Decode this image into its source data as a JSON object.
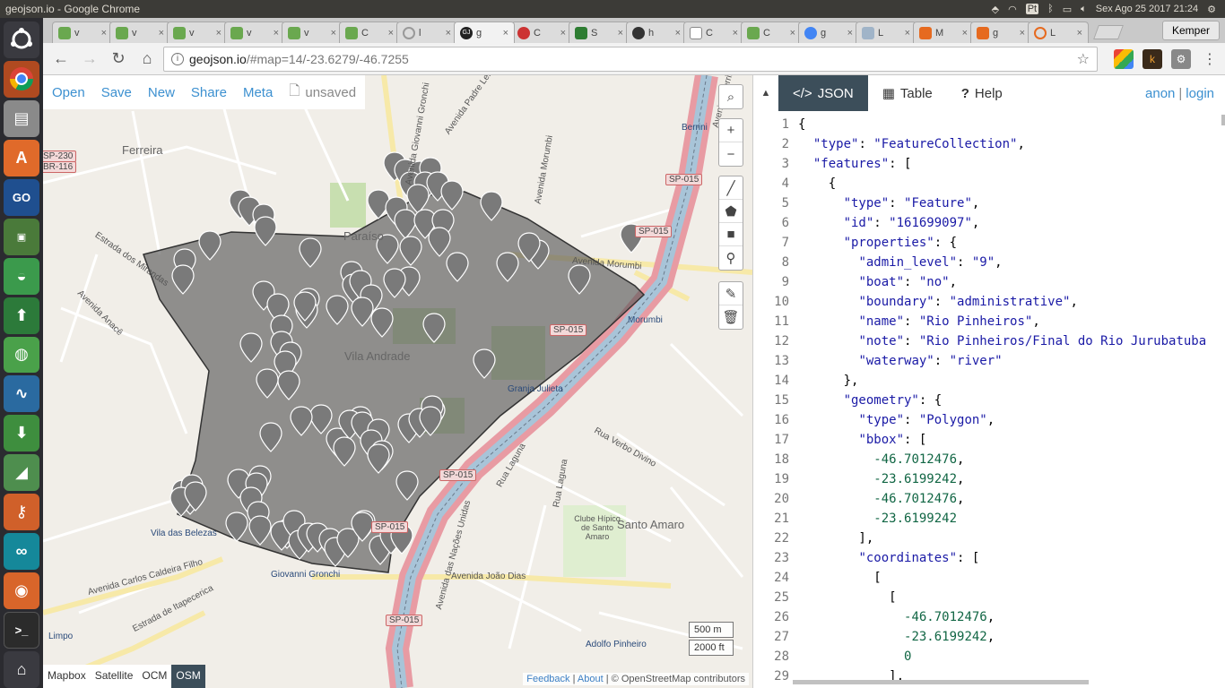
{
  "system_bar": {
    "window_title": "geojson.io - Google Chrome",
    "language": "Pt",
    "clock": "Sex Ago 25 2017 21:24"
  },
  "browser": {
    "tabs": [
      {
        "label": "v",
        "color": "#6aa84f"
      },
      {
        "label": "v",
        "color": "#6aa84f"
      },
      {
        "label": "v",
        "color": "#6aa84f"
      },
      {
        "label": "v",
        "color": "#6aa84f"
      },
      {
        "label": "v",
        "color": "#6aa84f"
      },
      {
        "label": "C",
        "color": "#6aa84f"
      },
      {
        "label": "l",
        "color": "#999999"
      },
      {
        "label": "g",
        "color": "#222222",
        "active": true
      },
      {
        "label": "C",
        "color": "#cc3333"
      },
      {
        "label": "S",
        "color": "#2e7d32"
      },
      {
        "label": "h",
        "color": "#333333"
      },
      {
        "label": "C",
        "color": "#888888"
      },
      {
        "label": "C",
        "color": "#6aa84f"
      },
      {
        "label": "g",
        "color": "#4285f4"
      },
      {
        "label": "L",
        "color": "#a0b4c8"
      },
      {
        "label": "M",
        "color": "#e66a1f"
      },
      {
        "label": "g",
        "color": "#e66a1f"
      },
      {
        "label": "L",
        "color": "#e66a1f"
      }
    ],
    "profile": "Kemper",
    "url_host": "geojson.io",
    "url_rest": "/#map=14/-23.6279/-46.7255"
  },
  "map_menu": {
    "open": "Open",
    "save": "Save",
    "new": "New",
    "share": "Share",
    "meta": "Meta",
    "unsaved": "unsaved"
  },
  "map": {
    "place_labels": [
      "Paraíso",
      "Vila Andrade",
      "Ferreira",
      "Santo Amaro",
      "Vila das Belezas",
      "Giovanni Gronchi",
      "Granja Julieta",
      "Morumbi",
      "Berrini",
      "Clube Hípico de Santo Amaro",
      "Adolfo Pinheiro",
      "Limpo"
    ],
    "road_labels": [
      "Avenida Giovanni Gronchi",
      "Avenida Morumbi",
      "Avenida Padre Lebret",
      "Estrada dos Mirandas",
      "Avenida Anacê",
      "Avenida Morumbi",
      "Rua Verbo Divino",
      "Rua Laguna",
      "Rua Laguna",
      "Avenida João Dias",
      "Avenida Carlos Caldeira Filho",
      "Estrada de Itapecerica",
      "Avenida das Nações Unidas",
      "Avenida Berrini"
    ],
    "shields": [
      "SP-230",
      "BR-116",
      "SP-015",
      "SP-015",
      "SP-015",
      "SP-015",
      "SP-015",
      "SP-015"
    ],
    "scale_metric": "500 m",
    "scale_imperial": "2000 ft",
    "layers": [
      "Mapbox",
      "Satellite",
      "OCM",
      "OSM"
    ],
    "active_layer": "OSM",
    "attribution": {
      "feedback": "Feedback",
      "about": "About",
      "copyright": "© OpenStreetMap contributors"
    }
  },
  "sidebar": {
    "tabs": {
      "json": "JSON",
      "table": "Table",
      "help": "Help"
    },
    "auth": {
      "anon": "anon",
      "sep": "|",
      "login": "login"
    }
  },
  "editor_lines": [
    "{",
    "  \"type\": \"FeatureCollection\",",
    "  \"features\": [",
    "    {",
    "      \"type\": \"Feature\",",
    "      \"id\": \"161699097\",",
    "      \"properties\": {",
    "        \"admin_level\": \"9\",",
    "        \"boat\": \"no\",",
    "        \"boundary\": \"administrative\",",
    "        \"name\": \"Rio Pinheiros\",",
    "        \"note\": \"Rio Pinheiros/Final do Rio Jurubatuba",
    "        \"waterway\": \"river\"",
    "      },",
    "      \"geometry\": {",
    "        \"type\": \"Polygon\",",
    "        \"bbox\": [",
    "          -46.7012476,",
    "          -23.6199242,",
    "          -46.7012476,",
    "          -23.6199242",
    "        ],",
    "        \"coordinates\": [",
    "          [",
    "            [",
    "              -46.7012476,",
    "              -23.6199242,",
    "              0",
    "            ],"
  ],
  "colors": {
    "accent_link": "#3c90d0",
    "active_tab_bg": "#3c4e5a",
    "json_key": "#1a1aa6",
    "json_number": "#116644"
  }
}
